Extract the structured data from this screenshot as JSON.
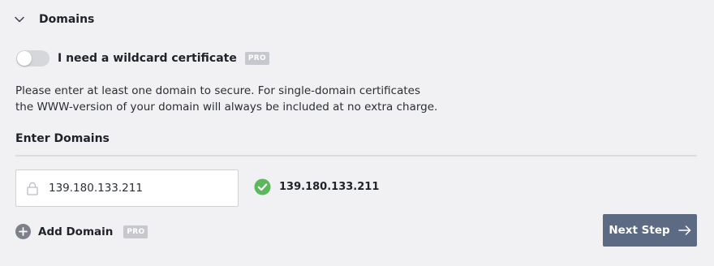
{
  "section": {
    "title": "Domains",
    "expanded": true
  },
  "wildcard": {
    "label": "I need a wildcard certificate",
    "enabled": false,
    "badge": "PRO"
  },
  "description": {
    "line1": "Please enter at least one domain to secure. For single-domain certificates",
    "line2": "the WWW-version of your domain will always be included at no extra charge."
  },
  "domains": {
    "label": "Enter Domains",
    "input_value": "139.180.133.211",
    "validated_value": "139.180.133.211"
  },
  "add_domain": {
    "label": "Add Domain",
    "badge": "PRO"
  },
  "next_button": {
    "label": "Next Step"
  },
  "icons": {
    "chevron": "chevron-down-icon",
    "lock": "lock-icon",
    "check": "check-circle-icon",
    "plus": "plus-circle-icon",
    "arrow": "arrow-right-icon"
  },
  "colors": {
    "background": "#f1f1f3",
    "success": "#5cb85c",
    "button": "#5d6a83",
    "badge": "#c6c8cd",
    "toggle_off": "#d6d7db"
  }
}
